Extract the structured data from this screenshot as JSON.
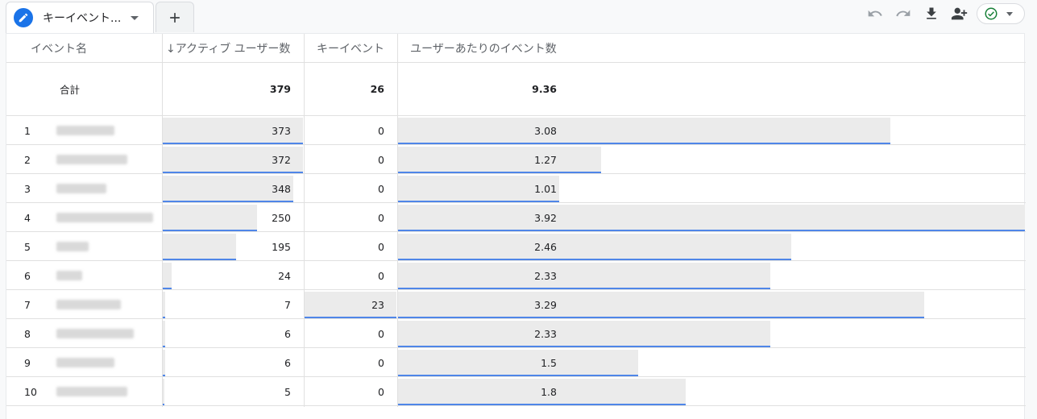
{
  "tab": {
    "label": "キーイベント..."
  },
  "columns": {
    "name": "イベント名",
    "active_users": "↓アクティブ ユーザー数",
    "key_events": "キーイベント",
    "per_user": "ユーザーあたりのイベント数"
  },
  "total": {
    "label": "合計",
    "active_users": "379",
    "key_events": "26",
    "per_user": "9.36"
  },
  "rows": [
    {
      "rank": "1",
      "active_users": "373",
      "key_events": "0",
      "per_user": "3.08"
    },
    {
      "rank": "2",
      "active_users": "372",
      "key_events": "0",
      "per_user": "1.27"
    },
    {
      "rank": "3",
      "active_users": "348",
      "key_events": "0",
      "per_user": "1.01"
    },
    {
      "rank": "4",
      "active_users": "250",
      "key_events": "0",
      "per_user": "3.92"
    },
    {
      "rank": "5",
      "active_users": "195",
      "key_events": "0",
      "per_user": "2.46"
    },
    {
      "rank": "6",
      "active_users": "24",
      "key_events": "0",
      "per_user": "2.33"
    },
    {
      "rank": "7",
      "active_users": "7",
      "key_events": "23",
      "per_user": "3.29"
    },
    {
      "rank": "8",
      "active_users": "6",
      "key_events": "0",
      "per_user": "2.33"
    },
    {
      "rank": "9",
      "active_users": "6",
      "key_events": "0",
      "per_user": "1.5"
    },
    {
      "rank": "10",
      "active_users": "5",
      "key_events": "0",
      "per_user": "1.8"
    }
  ],
  "icons": [
    "edit-icon",
    "dropdown-icon",
    "add-tab-icon",
    "undo-icon",
    "redo-icon",
    "download-icon",
    "share-user-icon",
    "check-circle-icon"
  ],
  "colors": {
    "accent": "#1a73e8",
    "bar_fill": "#ebebeb",
    "bar_line": "#4f86e8",
    "status_ok": "#188038"
  }
}
